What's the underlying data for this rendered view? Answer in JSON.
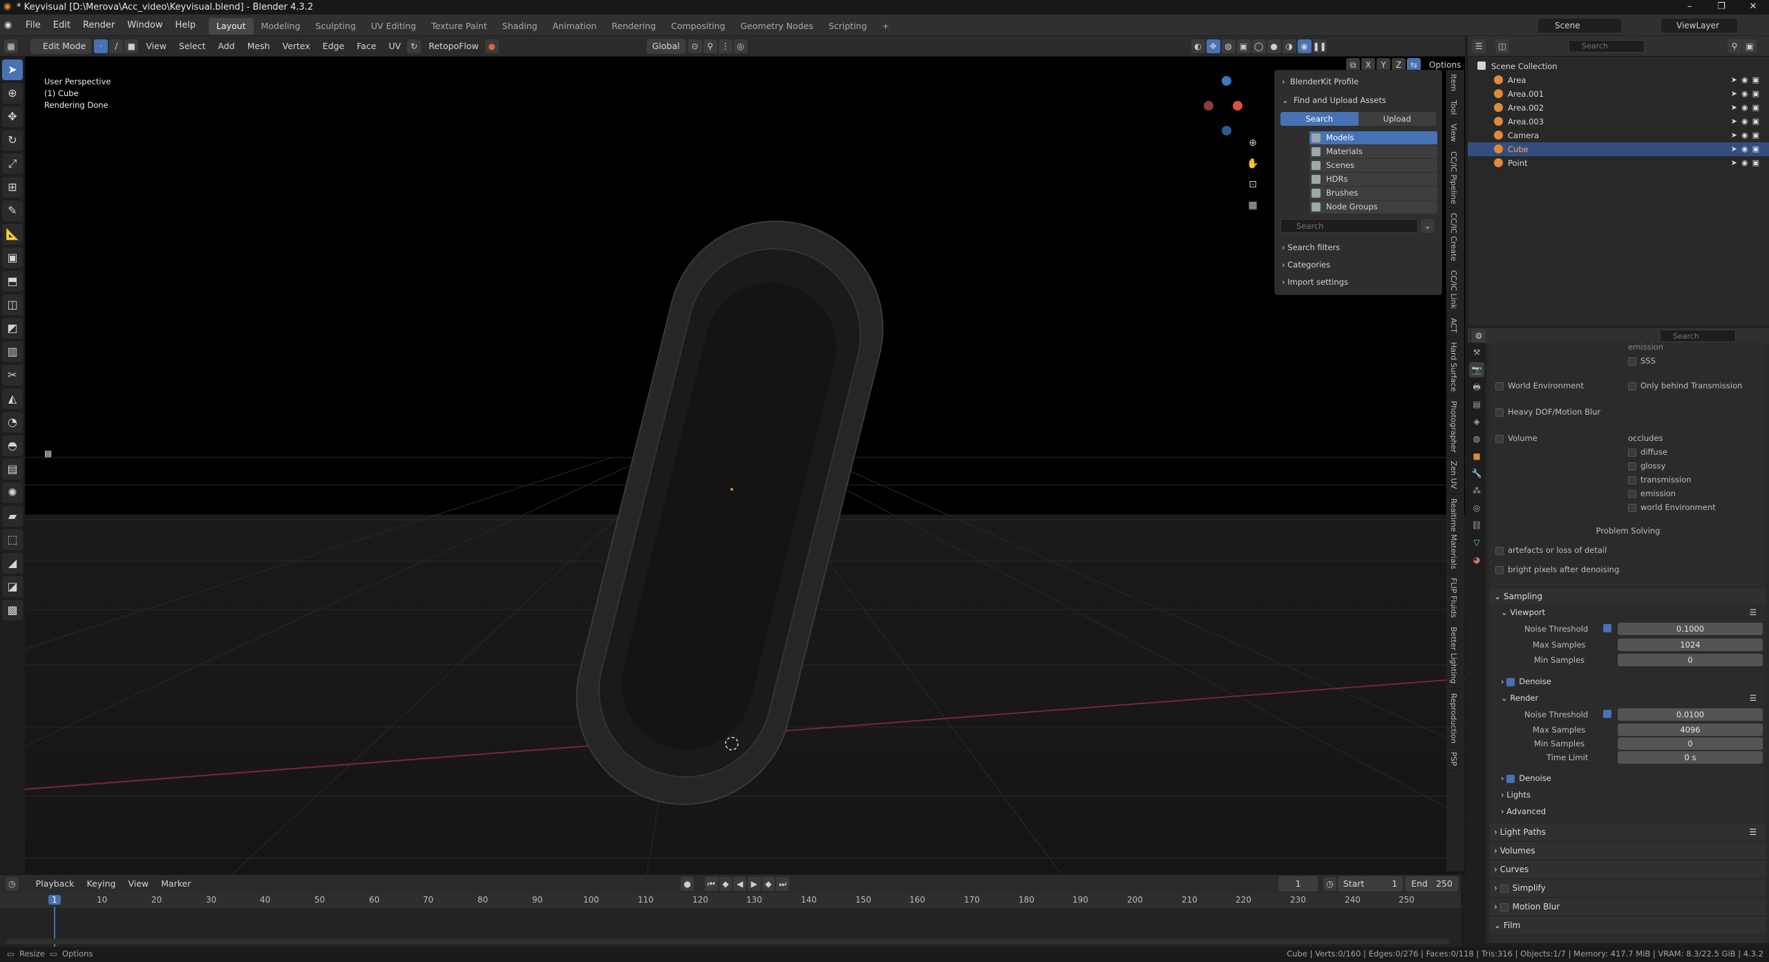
{
  "window": {
    "title": "* Keyvisual [D:\\Merova\\Acc_video\\Keyvisual.blend] - Blender 4.3.2"
  },
  "menu": [
    "File",
    "Edit",
    "Render",
    "Window",
    "Help"
  ],
  "workspaces": [
    "Layout",
    "Modeling",
    "Sculpting",
    "UV Editing",
    "Texture Paint",
    "Shading",
    "Animation",
    "Rendering",
    "Compositing",
    "Geometry Nodes",
    "Scripting"
  ],
  "active_workspace": "Layout",
  "scene": {
    "name": "Scene",
    "view_layer": "ViewLayer"
  },
  "viewport_header": {
    "mode": "Edit Mode",
    "menus": [
      "View",
      "Select",
      "Add",
      "Mesh",
      "Vertex",
      "Edge",
      "Face",
      "UV"
    ],
    "addon": "RetopoFlow",
    "orientation": "Global",
    "options": "Options",
    "xyz": [
      "X",
      "Y",
      "Z"
    ]
  },
  "viewport": {
    "line1": "User Perspective",
    "line2": "(1) Cube",
    "line3": "Rendering Done"
  },
  "blenderkit": {
    "profile": "BlenderKit Profile",
    "find": "Find and Upload Assets",
    "search_tab": "Search",
    "upload_tab": "Upload",
    "categories": [
      "Models",
      "Materials",
      "Scenes",
      "HDRs",
      "Brushes",
      "Node Groups"
    ],
    "search_placeholder": "Search",
    "search_filters": "Search filters",
    "categories_label": "Categories",
    "import_settings": "Import settings"
  },
  "side_tabs": [
    "Item",
    "Tool",
    "View",
    "CC/IC Pipeline",
    "CC/IC Create",
    "CC/IC Link",
    "ACT",
    "Hard Surface",
    "Photographer",
    "Zen UV",
    "Realtime Materials",
    "FLIP Fluids",
    "Better Lighting",
    "Reproduction",
    "PSP"
  ],
  "outliner": {
    "search_placeholder": "Search",
    "root": "Scene Collection",
    "items": [
      {
        "name": "Area",
        "selected": false
      },
      {
        "name": "Area.001",
        "selected": false
      },
      {
        "name": "Area.002",
        "selected": false
      },
      {
        "name": "Area.003",
        "selected": false
      },
      {
        "name": "Camera",
        "selected": false
      },
      {
        "name": "Cube",
        "selected": true
      },
      {
        "name": "Point",
        "selected": false
      }
    ]
  },
  "properties": {
    "search_placeholder": "Search",
    "top_partial": "emission",
    "sss": "SSS",
    "world_environment": "World Environment",
    "only_behind_transmission": "Only behind Transmission",
    "heavy_dof": "Heavy DOF/Motion Blur",
    "volume": "Volume",
    "occludes": "occludes",
    "occludes_items": [
      "diffuse",
      "glossy",
      "transmission",
      "emission",
      "world Environment"
    ],
    "problem_solving": "Problem Solving",
    "artefacts": "artefacts or loss of detail",
    "bright_pixels": "bright pixels after denoising",
    "sampling": "Sampling",
    "viewport": "Viewport",
    "render": "Render",
    "noise_threshold": "Noise Threshold",
    "max_samples": "Max Samples",
    "min_samples": "Min Samples",
    "time_limit": "Time Limit",
    "denoise": "Denoise",
    "vp_noise": "0.1000",
    "vp_max": "1024",
    "vp_min": "0",
    "r_noise": "0.0100",
    "r_max": "4096",
    "r_min": "0",
    "r_time": "0 s",
    "lights": "Lights",
    "advanced": "Advanced",
    "panels": [
      "Light Paths",
      "Volumes",
      "Curves",
      "Simplify",
      "Motion Blur",
      "Film"
    ]
  },
  "timeline": {
    "menus": [
      "Playback",
      "Keying",
      "View",
      "Marker"
    ],
    "current_frame": "1",
    "start_label": "Start",
    "start": "1",
    "end_label": "End",
    "end": "250",
    "ticks": [
      "1",
      "10",
      "20",
      "30",
      "40",
      "50",
      "60",
      "70",
      "80",
      "90",
      "100",
      "110",
      "120",
      "130",
      "140",
      "150",
      "160",
      "170",
      "180",
      "190",
      "200",
      "210",
      "220",
      "230",
      "240",
      "250"
    ]
  },
  "statusbar": {
    "left1": "Resize",
    "left2": "Options",
    "right": "Cube | Verts:0/160 | Edges:0/276 | Faces:0/118 | Tris:316 | Objects:1/7 | Memory: 417.7 MiB | VRAM: 8.3/22.5 GiB | 4.3.2"
  }
}
